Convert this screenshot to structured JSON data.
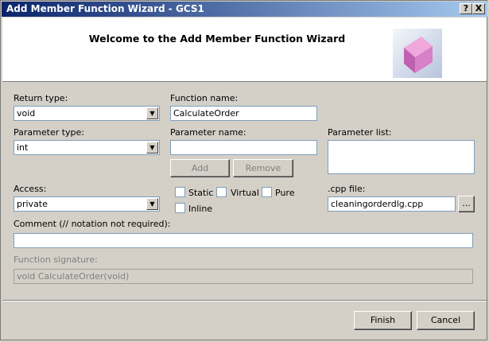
{
  "window": {
    "title": "Add Member Function Wizard - GCS1",
    "help_button": "?",
    "close_button": "X"
  },
  "banner": {
    "welcome": "Welcome to the Add Member Function Wizard",
    "icon": "wizard-cube-icon"
  },
  "form": {
    "return_type": {
      "label": "Return type:",
      "value": "void"
    },
    "function_name": {
      "label": "Function name:",
      "value": "CalculateOrder"
    },
    "parameter_type": {
      "label": "Parameter type:",
      "value": "int"
    },
    "parameter_name": {
      "label": "Parameter name:",
      "value": ""
    },
    "parameter_list": {
      "label": "Parameter list:"
    },
    "add_button": "Add",
    "remove_button": "Remove",
    "access": {
      "label": "Access:",
      "value": "private"
    },
    "checkboxes": {
      "static": {
        "label": "Static",
        "checked": false
      },
      "virtual": {
        "label": "Virtual",
        "checked": false
      },
      "pure": {
        "label": "Pure",
        "checked": false
      },
      "inline": {
        "label": "Inline",
        "checked": false
      }
    },
    "cpp_file": {
      "label": ".cpp file:",
      "value": "cleaningorderdlg.cpp",
      "browse": "..."
    },
    "comment": {
      "label": "Comment (// notation not required):",
      "value": ""
    },
    "signature": {
      "label": "Function signature:",
      "value": "void CalculateOrder(void)"
    }
  },
  "footer": {
    "finish": "Finish",
    "cancel": "Cancel"
  }
}
